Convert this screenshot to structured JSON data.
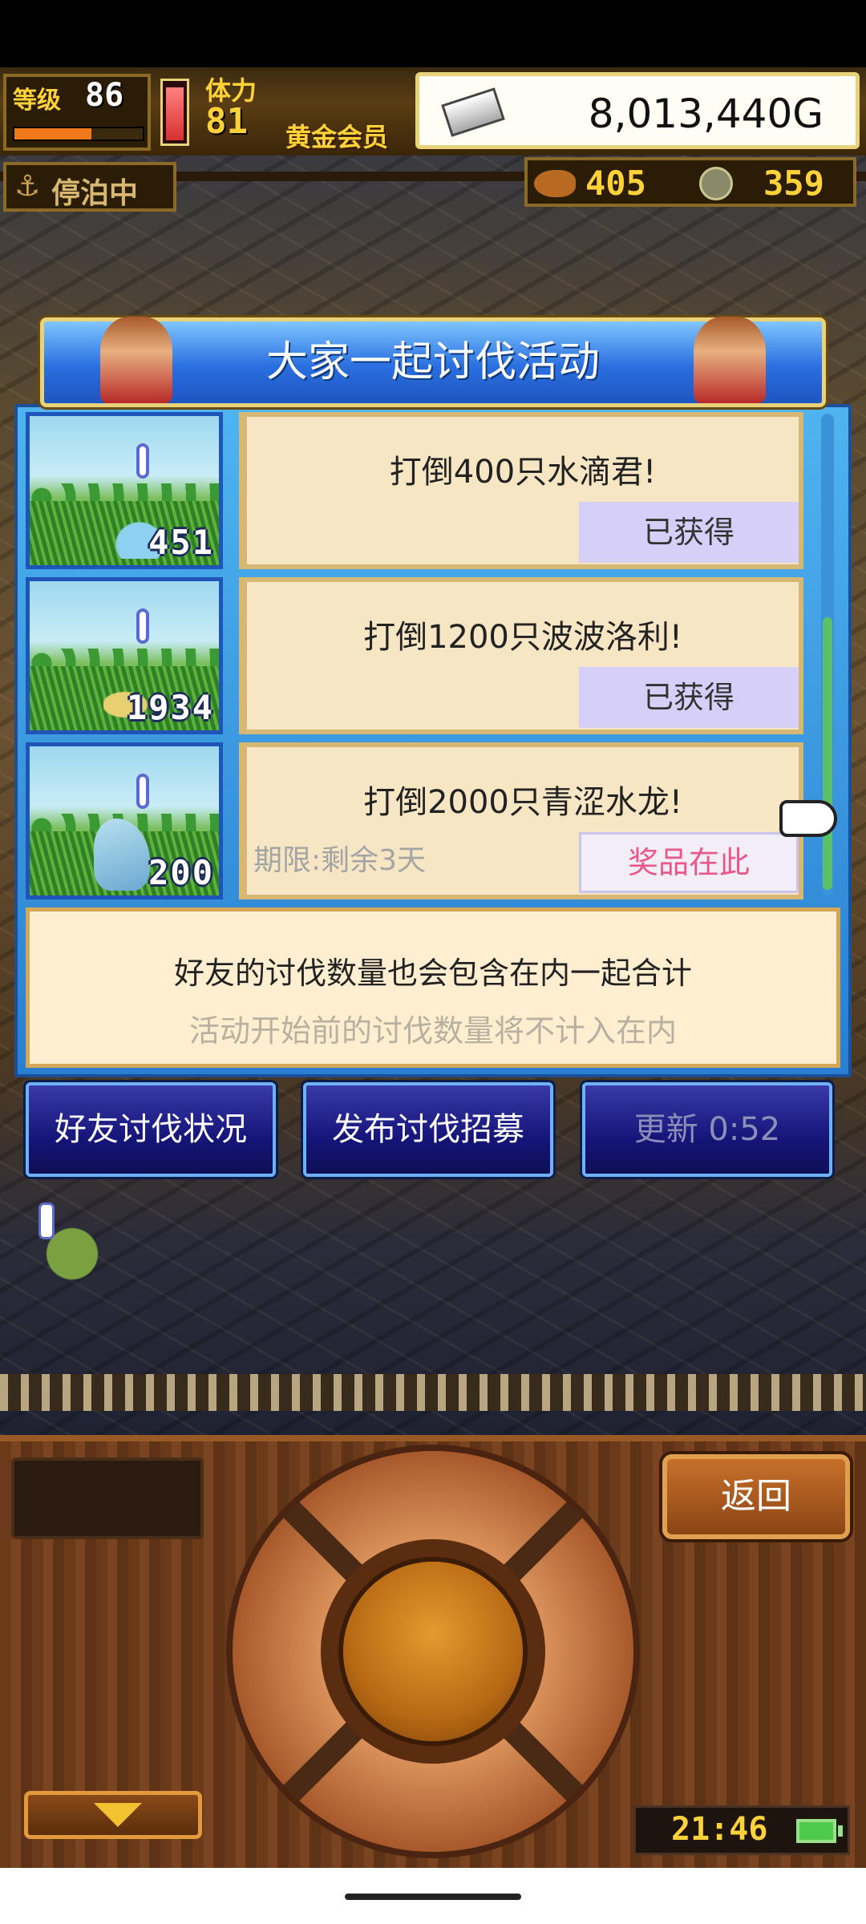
{
  "hud": {
    "level_label": "等级",
    "level_value": "86",
    "stamina_label": "体力",
    "stamina_value": "81",
    "membership": "黄金会员",
    "gold": "8,013,440G",
    "status": "停泊中",
    "resource_a": "405",
    "resource_b": "359",
    "level_progress": 0.6,
    "stamina_progress": 0.95
  },
  "dialog": {
    "title": "大家一起讨伐活动",
    "quests": [
      {
        "count": "451",
        "name": "打倒400只水滴君!",
        "status": "已获得",
        "deadline": ""
      },
      {
        "count": "1934",
        "name": "打倒1200只波波洛利!",
        "status": "已获得",
        "deadline": ""
      },
      {
        "count": "200",
        "name": "打倒2000只青涩水龙!",
        "status": "奖品在此",
        "deadline": "期限:剩余3天"
      }
    ],
    "info_line1": "好友的讨伐数量也会包含在内一起合计",
    "info_line2": "活动开始前的讨伐数量将不计入在内",
    "buttons": {
      "friend_status": "好友讨伐状况",
      "post_recruit": "发布讨伐招募",
      "refresh": "更新 0:52"
    }
  },
  "controls": {
    "back": "返回",
    "clock": "21:46"
  },
  "colors": {
    "accent_blue": "#2a7fd0",
    "claimed_bg": "#d6d0f8",
    "claim_text": "#e8578e",
    "gold_text": "#ffd23a"
  }
}
